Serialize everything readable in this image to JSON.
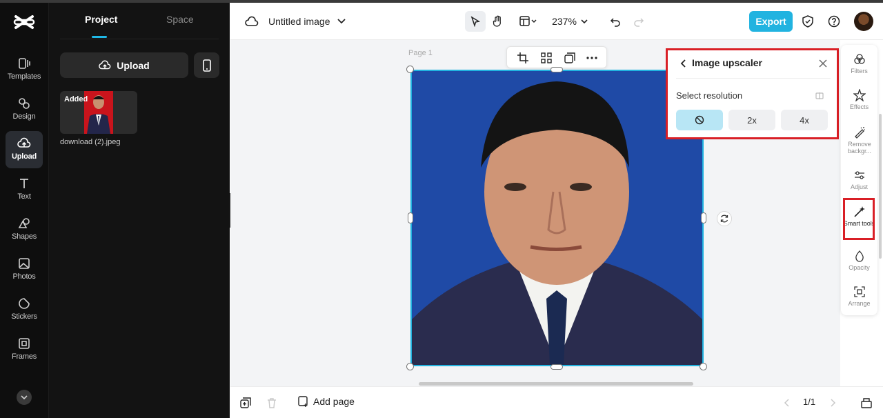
{
  "app": {
    "title": "Untitled image"
  },
  "rail": {
    "items": [
      {
        "label": "Templates",
        "icon": "templates-icon"
      },
      {
        "label": "Design",
        "icon": "design-icon"
      },
      {
        "label": "Upload",
        "icon": "upload-cloud-icon",
        "active": true
      },
      {
        "label": "Text",
        "icon": "text-icon"
      },
      {
        "label": "Shapes",
        "icon": "shapes-icon"
      },
      {
        "label": "Photos",
        "icon": "photos-icon"
      },
      {
        "label": "Stickers",
        "icon": "stickers-icon"
      },
      {
        "label": "Frames",
        "icon": "frames-icon"
      }
    ]
  },
  "panel": {
    "tabs": [
      {
        "label": "Project",
        "active": true
      },
      {
        "label": "Space",
        "active": false
      }
    ],
    "upload_label": "Upload",
    "asset": {
      "badge": "Added",
      "filename": "download (2).jpeg"
    }
  },
  "header": {
    "zoom": "237%",
    "export_label": "Export"
  },
  "canvas": {
    "page_label": "Page 1"
  },
  "upscaler": {
    "title": "Image upscaler",
    "resolution_label": "Select resolution",
    "options": [
      {
        "label": "",
        "icon": "none-icon",
        "selected": true
      },
      {
        "label": "2x",
        "selected": false
      },
      {
        "label": "4x",
        "selected": false
      }
    ]
  },
  "right_tools": [
    {
      "label": "Filters",
      "icon": "filters-icon"
    },
    {
      "label": "Effects",
      "icon": "effects-icon"
    },
    {
      "label": "Remove backgr...",
      "icon": "remove-background-icon"
    },
    {
      "label": "Adjust",
      "icon": "adjust-icon"
    },
    {
      "label": "Smart tools",
      "icon": "smart-tools-icon",
      "highlighted": true
    },
    {
      "label": "Opacity",
      "icon": "opacity-icon"
    },
    {
      "label": "Arrange",
      "icon": "arrange-icon"
    }
  ],
  "footer": {
    "add_page_label": "Add page",
    "pager": "1/1"
  },
  "colors": {
    "accent": "#21b3e0",
    "highlight_border": "#d91f26",
    "rail_bg": "#0e0e0e",
    "panel_bg": "#131313",
    "photo_bg": "#1f4aa6"
  }
}
